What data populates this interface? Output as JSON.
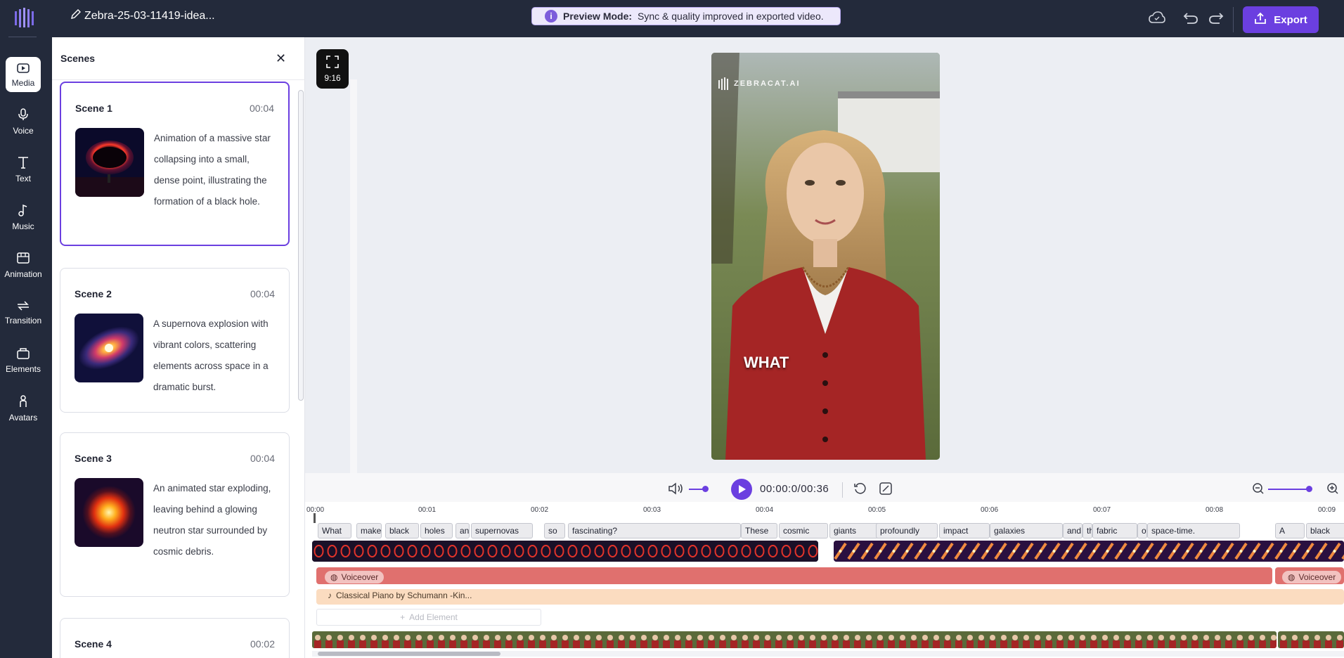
{
  "app": {
    "project_title": "Zebra-25-03-11419-idea...",
    "preview_banner_bold": "Preview Mode:",
    "preview_banner_text": "Sync & quality improved in exported video.",
    "export_label": "Export",
    "accent_color": "#6b3fe0"
  },
  "sidebar": {
    "items": [
      {
        "label": "Media",
        "icon": "media-icon"
      },
      {
        "label": "Voice",
        "icon": "microphone-icon"
      },
      {
        "label": "Text",
        "icon": "text-icon"
      },
      {
        "label": "Music",
        "icon": "music-note-icon"
      },
      {
        "label": "Animation",
        "icon": "animation-icon"
      },
      {
        "label": "Transition",
        "icon": "transition-icon"
      },
      {
        "label": "Elements",
        "icon": "elements-icon"
      },
      {
        "label": "Avatars",
        "icon": "avatar-icon"
      }
    ]
  },
  "scenes": {
    "header": "Scenes",
    "items": [
      {
        "name": "Scene 1",
        "duration": "00:04",
        "description": "Animation of a massive star collapsing into a small, dense point, illustrating the formation of a black hole."
      },
      {
        "name": "Scene 2",
        "duration": "00:04",
        "description": "A supernova explosion with vibrant colors, scattering elements across space in a dramatic burst."
      },
      {
        "name": "Scene 3",
        "duration": "00:04",
        "description": "An animated star exploding, leaving behind a glowing neutron star surrounded by cosmic debris."
      },
      {
        "name": "Scene 4",
        "duration": "00:02",
        "description": ""
      }
    ]
  },
  "preview": {
    "aspect_ratio": "9:16",
    "watermark": "ZEBRACAT.AI",
    "caption": "WHAT"
  },
  "player": {
    "timecode": "00:00:0/00:36"
  },
  "timeline": {
    "ruler": [
      "00:00",
      "00:01",
      "00:02",
      "00:03",
      "00:04",
      "00:05",
      "00:06",
      "00:07",
      "00:08",
      "00:09"
    ],
    "words": [
      "What",
      "makes",
      "black",
      "holes",
      "and",
      "supernovas",
      "so",
      "fascinating?",
      "These",
      "cosmic",
      "giants",
      "profoundly",
      "impact",
      "galaxies",
      "and",
      "the",
      "fabric",
      "of",
      "space-time.",
      "A",
      "black"
    ],
    "voiceover_label": "Voiceover",
    "music_label": "Classical Piano by Schumann -Kin...",
    "add_element_label": "Add Element"
  }
}
